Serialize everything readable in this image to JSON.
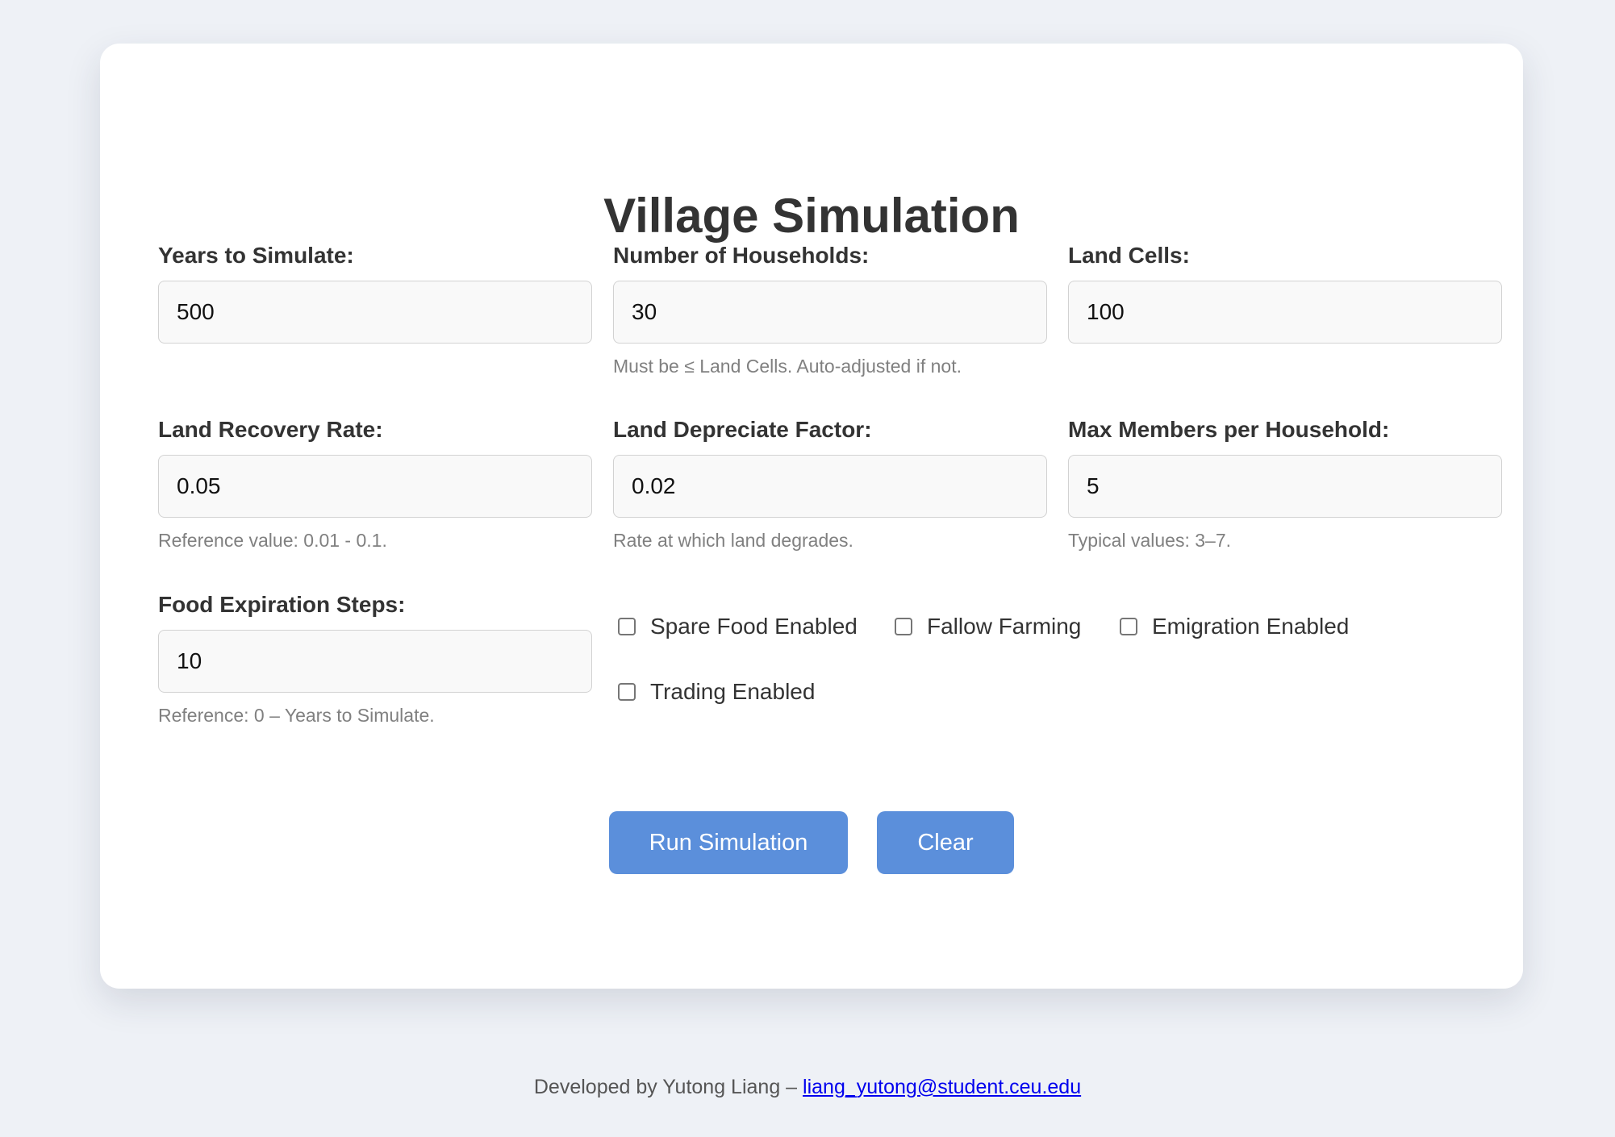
{
  "page": {
    "title": "Village Simulation"
  },
  "fields": [
    {
      "label": "Years to Simulate:",
      "value": "500",
      "hint": ""
    },
    {
      "label": "Number of Households:",
      "value": "30",
      "hint": "Must be ≤ Land Cells. Auto-adjusted if not."
    },
    {
      "label": "Land Cells:",
      "value": "100",
      "hint": ""
    },
    {
      "label": "Land Recovery Rate:",
      "value": "0.05",
      "hint": "Reference value: 0.01 - 0.1."
    },
    {
      "label": "Land Depreciate Factor:",
      "value": "0.02",
      "hint": "Rate at which land degrades."
    },
    {
      "label": "Max Members per Household:",
      "value": "5",
      "hint": "Typical values: 3–7."
    },
    {
      "label": "Food Expiration Steps:",
      "value": "10",
      "hint": "Reference: 0 – Years to Simulate."
    }
  ],
  "checkboxes": [
    {
      "label": "Spare Food Enabled",
      "checked": false
    },
    {
      "label": "Fallow Farming",
      "checked": false
    },
    {
      "label": "Emigration Enabled",
      "checked": false
    },
    {
      "label": "Trading Enabled",
      "checked": false
    }
  ],
  "buttons": {
    "run_label": "Run Simulation",
    "clear_label": "Clear"
  },
  "footer": {
    "text": "Developed by Yutong Liang – ",
    "email": "liang_yutong@student.ceu.edu"
  },
  "colors": {
    "background": "#eef1f6",
    "card": "#ffffff",
    "accent": "#5b8fdb",
    "input_bg": "#f9f9f9",
    "hint": "#808080",
    "link": "#0000ee"
  }
}
